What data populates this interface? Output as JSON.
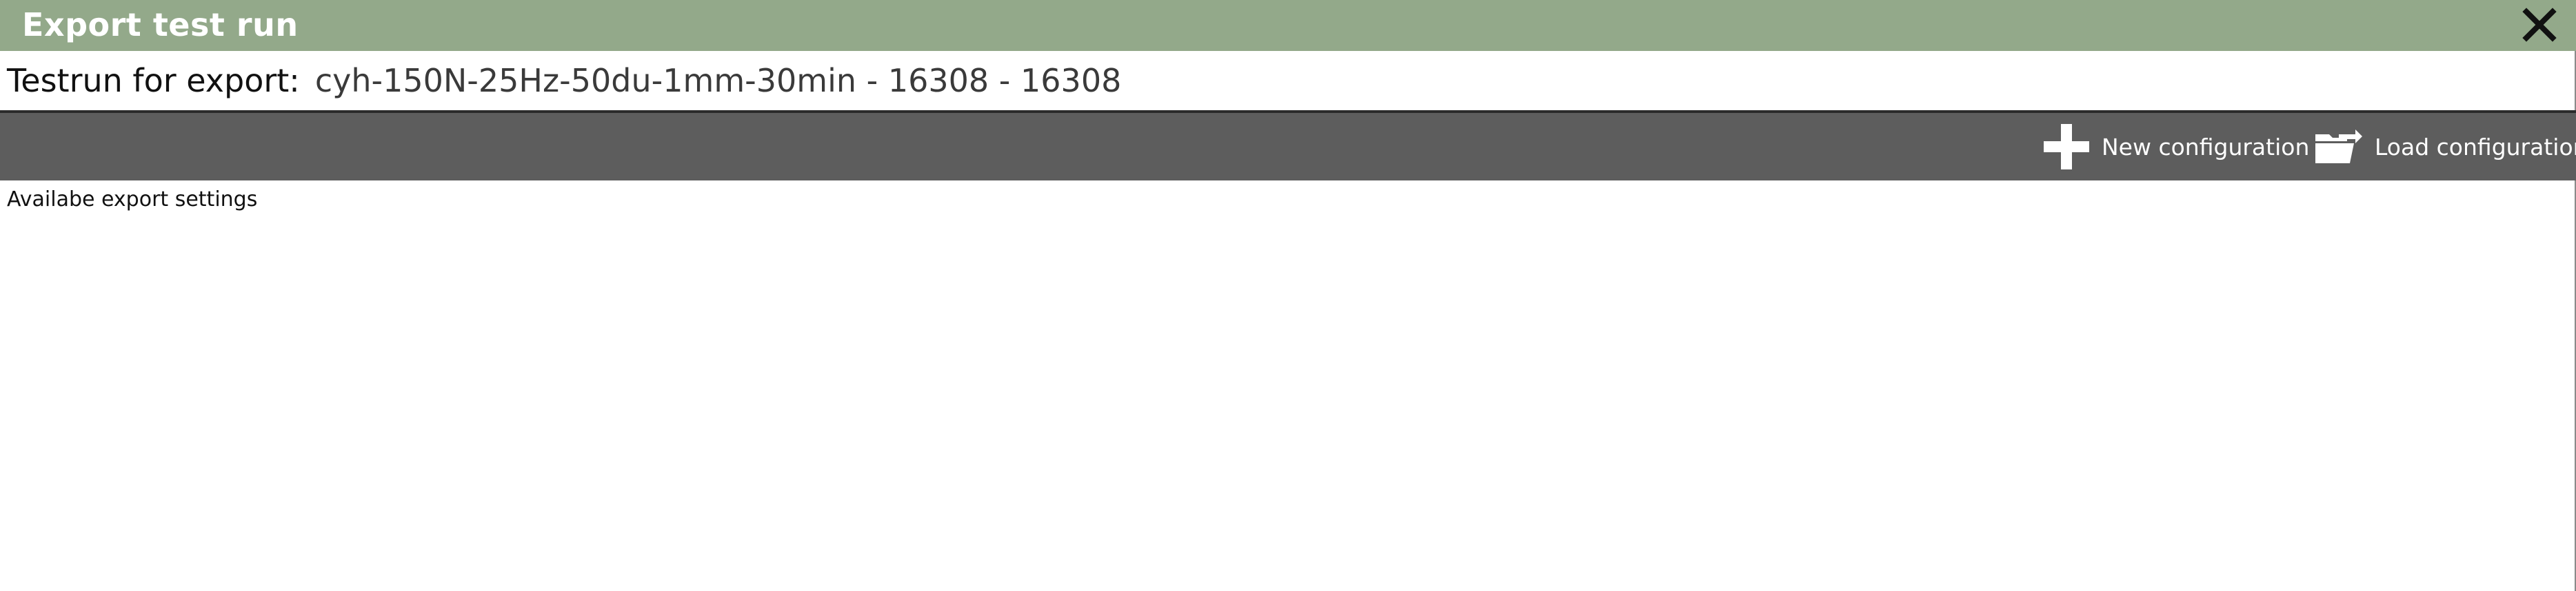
{
  "window": {
    "title": "Export test run",
    "close_icon": "close-icon"
  },
  "testrun": {
    "label": "Testrun for export:",
    "value": "cyh-150N-25Hz-50du-1mm-30min - 16308 - 16308"
  },
  "toolbar": {
    "new_config": {
      "label": "New configuration",
      "icon": "plus-icon"
    },
    "load_config": {
      "label": "Load configuration",
      "icon": "folder-load-icon"
    }
  },
  "main": {
    "section_label": "Availabe export settings"
  },
  "colors": {
    "titlebar": "#93a98a",
    "toolbar": "#5d5d5d",
    "background": "#ffffff"
  }
}
